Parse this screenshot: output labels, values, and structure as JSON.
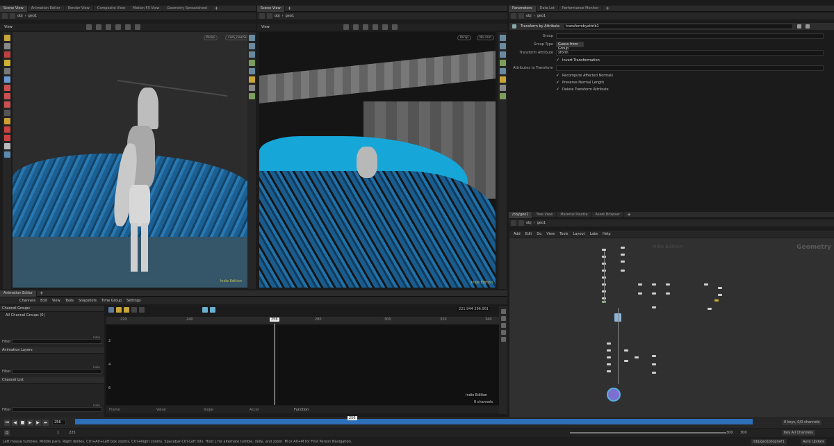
{
  "left_tabs": [
    "Scene View",
    "Animation Editor",
    "Render View",
    "Composite View",
    "Motion FX View",
    "Geometry Spreadsheet"
  ],
  "mid_tabs": [
    "Scene View"
  ],
  "right_tabs": [
    "Parameters",
    "Data Lot",
    "Performance Monitor"
  ],
  "net_tabs": [
    "/obj/geo1",
    "Tree View",
    "Material Palette",
    "Asset Browser"
  ],
  "path": {
    "obj": "obj",
    "geo": "geo1"
  },
  "view_label": "View",
  "left_view": {
    "persp": "Persp",
    "cam": "cam_nearSide",
    "watermark": "Indie Edition"
  },
  "mid_view": {
    "persp": "Persp",
    "cam": "No cam",
    "watermark": "Indie Edition"
  },
  "params": {
    "node_type": "Transform by Attribute",
    "node_name": "transformbyattrib1",
    "group_label": "Group",
    "group_type_label": "Group Type",
    "group_type_value": "Guess from Group",
    "transform_attr_label": "Transform Attribute",
    "transform_attr_value": "xform",
    "invert_label": "Invert Transformation",
    "attrs_label": "Attributes to Transform",
    "recompute_label": "Recompute Affected Normals",
    "preserve_label": "Preserve Normal Length",
    "delete_label": "Delete Transform Attribute"
  },
  "network": {
    "menu": [
      "Add",
      "Edit",
      "Go",
      "View",
      "Tools",
      "Layout",
      "Labs",
      "Help"
    ],
    "watermark": "Indie Edition",
    "context": "Geometry"
  },
  "anim": {
    "tab": "Animation Editor",
    "menu": [
      "Channels",
      "Edit",
      "View",
      "Tools",
      "Snapshots",
      "Time Group",
      "Settings"
    ],
    "channel_groups": "Channel Groups",
    "all_groups": "All Channel Groups (0)",
    "filter": "Filter",
    "anim_layers": "Animation Layers",
    "channel_list": "Channel List",
    "indie": "Indie",
    "coord": "221.944",
    "coord2": "296.001",
    "ruler": [
      "220",
      "240",
      "256",
      "260",
      "280",
      "300",
      "320",
      "340"
    ],
    "yticks": [
      "2",
      "4",
      "6"
    ],
    "current": "256",
    "bottom": [
      "Frame",
      "Value",
      "Slope",
      "Accel",
      "Function"
    ],
    "watermark": "Indie Edition",
    "channels": "0 channels"
  },
  "timeline": {
    "frame": "256",
    "start": "1",
    "start2": "225",
    "end": "300",
    "end2": "300",
    "keys": "0 keys, 0/0 channels",
    "key_all": "Key All Channels"
  },
  "status": {
    "text": "Left mouse tumbles. Middle pans. Right dollies. Ctrl+Alt+Left box zooms. Ctrl+Right zooms. Spacebar-Ctrl-Left tilts. Hold L for alternate tumble, dolly, and zoom.    M or Alt+M for First Person Navigation.",
    "path": "/obj/geo1/dopnet1",
    "auto": "Auto Update"
  }
}
